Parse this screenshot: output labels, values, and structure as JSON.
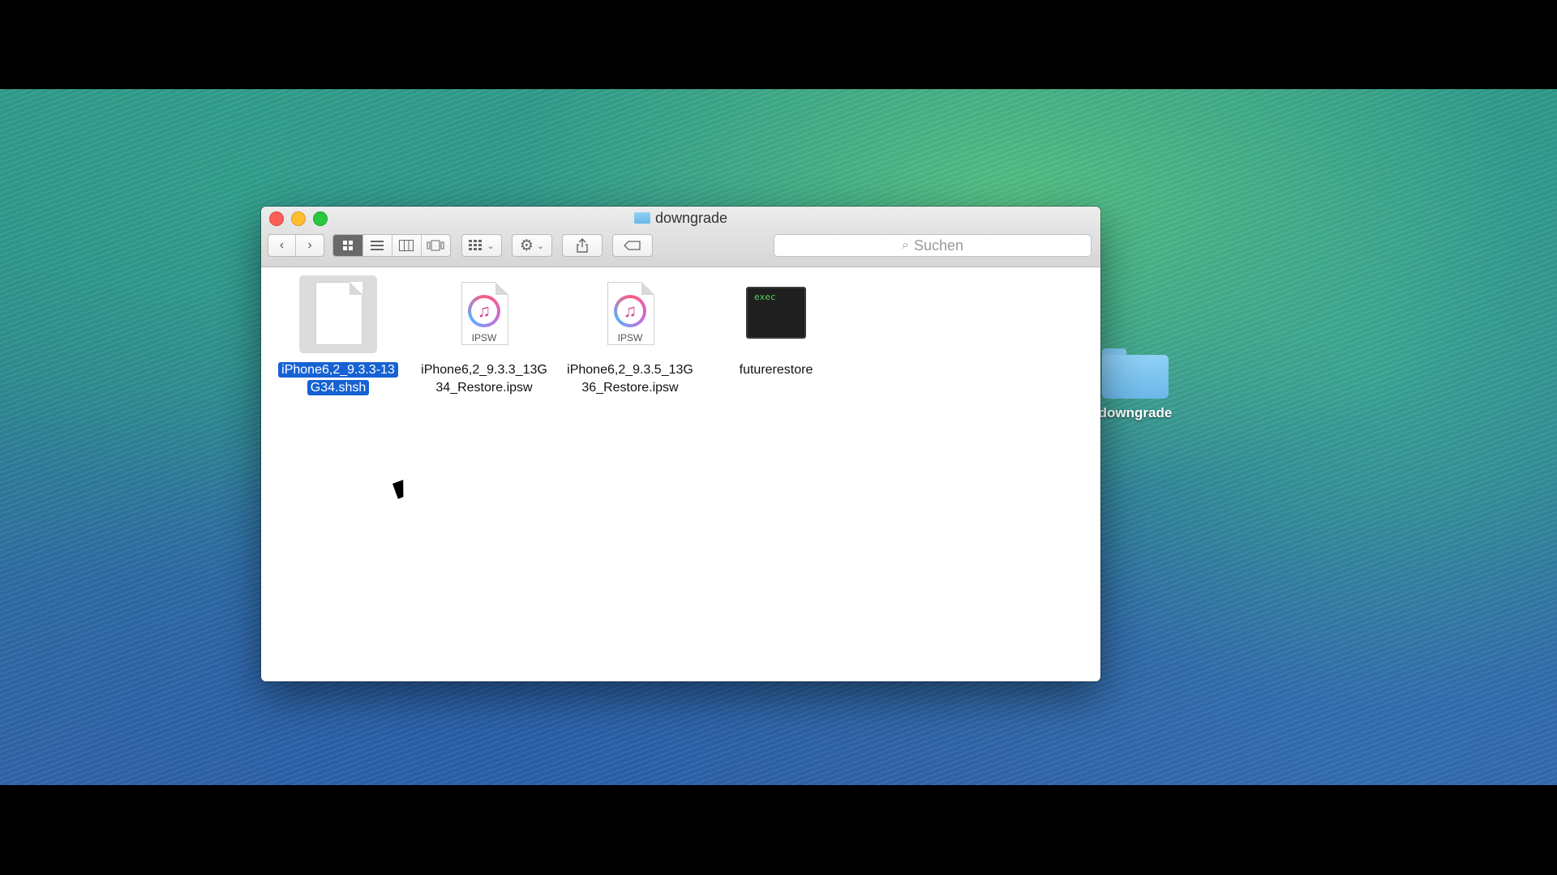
{
  "window": {
    "title": "downgrade",
    "search_placeholder": "Suchen"
  },
  "toolbar": {
    "back_icon": "chevron-left-icon",
    "forward_icon": "chevron-right-icon",
    "views": [
      "icon-view-icon",
      "list-view-icon",
      "column-view-icon",
      "coverflow-view-icon"
    ],
    "active_view": "icon-view",
    "arrange_icon": "arrange-grid-icon",
    "action_icon": "gear-icon",
    "share_icon": "share-icon",
    "tag_icon": "tag-icon"
  },
  "files": [
    {
      "name": "iPhone6,2_9.3.3-13G34.shsh",
      "type": "document",
      "selected": true
    },
    {
      "name": "iPhone6,2_9.3.3_13G34_Restore.ipsw",
      "type": "ipsw",
      "badge": "IPSW"
    },
    {
      "name": "iPhone6,2_9.3.5_13G36_Restore.ipsw",
      "type": "ipsw",
      "badge": "IPSW"
    },
    {
      "name": "futurerestore",
      "type": "executable",
      "badge": "exec"
    }
  ],
  "desktop": {
    "folder_label": "downgrade"
  },
  "colors": {
    "selection": "#1662d3",
    "close": "#fc5f57",
    "minimize": "#fdbd2e",
    "zoom": "#28c840"
  }
}
